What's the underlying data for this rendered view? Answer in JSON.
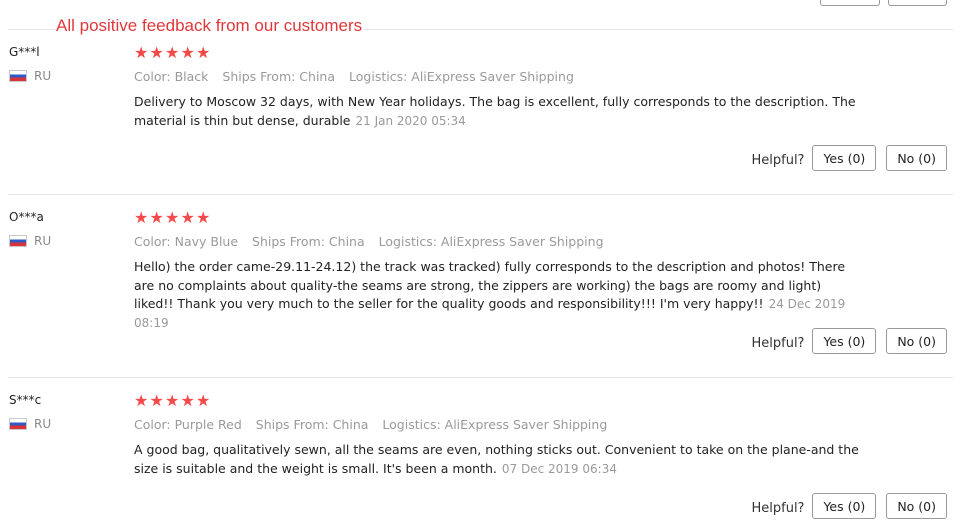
{
  "headline": "All positive feedback from our customers",
  "helpful_label": "Helpful?",
  "reviews": [
    {
      "name": "G***l",
      "country": "RU",
      "rating": 5,
      "color": "Color: Black",
      "ships_from": "Ships From: China",
      "logistics": "Logistics: AliExpress Saver Shipping",
      "text": "Delivery to Moscow 32 days, with New Year holidays. The bag is excellent, fully corresponds to the description. The material is thin but dense, durable",
      "date": "21 Jan 2020 05:34",
      "yes": "Yes (0)",
      "no": "No (0)"
    },
    {
      "name": "O***a",
      "country": "RU",
      "rating": 5,
      "color": "Color: Navy Blue",
      "ships_from": "Ships From: China",
      "logistics": "Logistics: AliExpress Saver Shipping",
      "text": "Hello) the order came-29.11-24.12) the track was tracked) fully corresponds to the description and photos! There are no complaints about quality-the seams are strong, the zippers are working) the bags are roomy and light) liked!! Thank you very much to the seller for the quality goods and responsibility!!! I'm very happy!!",
      "date": "24 Dec 2019 08:19",
      "yes": "Yes (0)",
      "no": "No (0)"
    },
    {
      "name": "S***c",
      "country": "RU",
      "rating": 5,
      "color": "Color: Purple Red",
      "ships_from": "Ships From: China",
      "logistics": "Logistics: AliExpress Saver Shipping",
      "text": "A good bag, qualitatively sewn, all the seams are even, nothing sticks out. Convenient to take on the plane-and the size is suitable and the weight is small. It's been a month.",
      "date": "07 Dec 2019 06:34",
      "yes": "Yes (0)",
      "no": "No (0)"
    }
  ],
  "colors": {
    "headline": "#e0383b",
    "stars": "#f44a4a",
    "meta": "#9a9a9a"
  },
  "icons": {
    "star": "star-icon",
    "flag": "russia-flag-icon"
  }
}
